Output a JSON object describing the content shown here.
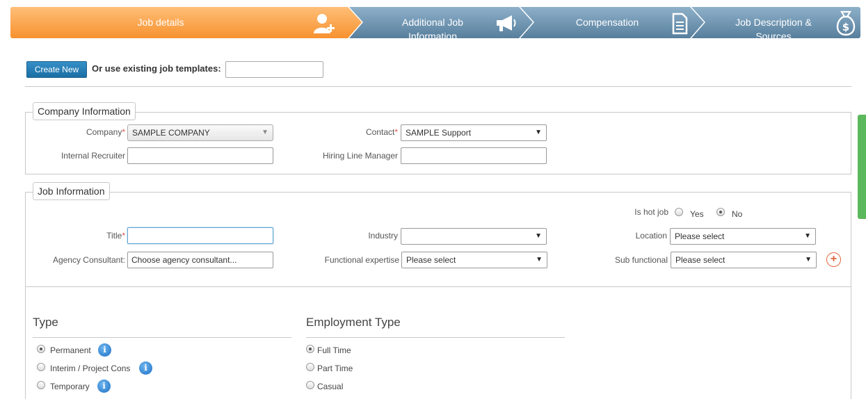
{
  "wizard": {
    "steps": [
      {
        "label": "Job details",
        "icon": "add-user-icon"
      },
      {
        "label": "Additional Job Information",
        "icon": "megaphone-icon"
      },
      {
        "label": "Compensation",
        "icon": "document-icon"
      },
      {
        "label": "Job Description & Sources",
        "icon": "money-bag-icon"
      }
    ]
  },
  "top": {
    "create_label": "Create New",
    "template_label": "Or use existing job templates:",
    "template_value": ""
  },
  "company": {
    "legend": "Company Information",
    "company_label": "Company",
    "company_value": "SAMPLE COMPANY",
    "contact_label": "Contact",
    "contact_value": "SAMPLE Support",
    "recruiter_label": "Internal Recruiter",
    "recruiter_value": "",
    "manager_label": "Hiring Line Manager",
    "manager_value": ""
  },
  "job": {
    "legend": "Job Information",
    "hot_label": "Is hot job",
    "hot_yes": "Yes",
    "hot_no": "No",
    "hot_selected": "No",
    "title_label": "Title",
    "industry_label": "Industry",
    "industry_value": "",
    "location_label": "Location",
    "location_value": "Please select",
    "agency_label": "Agency Consultant:",
    "agency_placeholder": "Choose agency consultant...",
    "functional_label": "Functional expertise",
    "functional_value": "Please select",
    "subfunctional_label": "Sub functional",
    "subfunctional_value": "Please select"
  },
  "type": {
    "title": "Type",
    "options": [
      "Permanent",
      "Interim / Project Cons",
      "Temporary"
    ],
    "selected": "Permanent"
  },
  "employment": {
    "title": "Employment Type",
    "options": [
      "Full Time",
      "Part Time",
      "Casual"
    ],
    "selected": "Full Time"
  },
  "colors": {
    "active_step": "#f7922f",
    "inactive_step": "#577f9d",
    "primary_button": "#1a6ea4",
    "required": "#d9534f",
    "add_icon": "#e0633a",
    "side_tab": "#5cb85c"
  }
}
